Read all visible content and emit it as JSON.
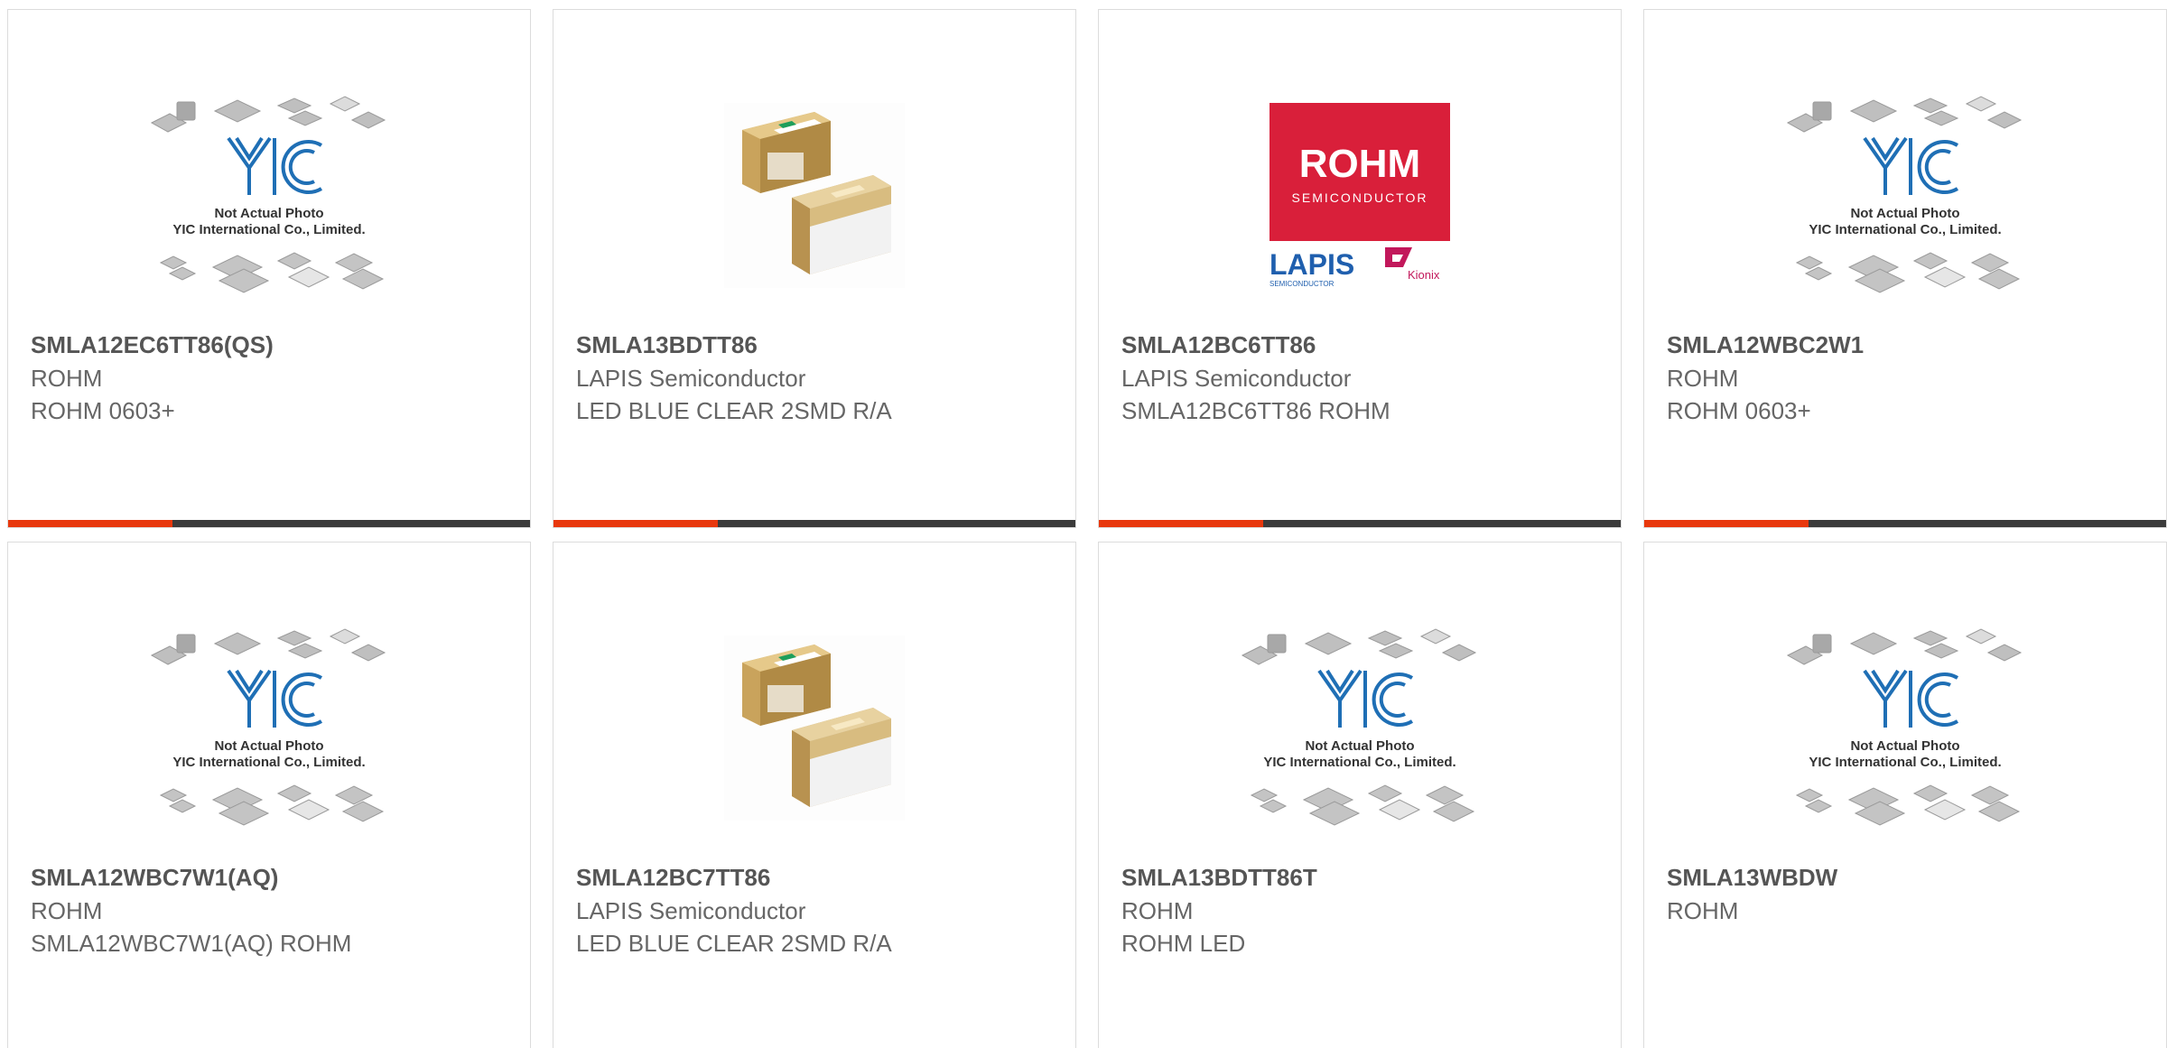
{
  "placeholder": {
    "logo_text": "YIC",
    "line1": "Not Actual Photo",
    "line2": "YIC International Co., Limited."
  },
  "rohm_logo": {
    "brand": "ROHM",
    "sub": "SEMICONDUCTOR",
    "lapis": "LAPIS",
    "lapis_sub": "SEMICONDUCTOR",
    "kionix": "Kionix"
  },
  "products": [
    {
      "part": "SMLA12EC6TT86(QS)",
      "manufacturer": "ROHM",
      "description": "ROHM 0603+",
      "image": "placeholder"
    },
    {
      "part": "SMLA13BDTT86",
      "manufacturer": "LAPIS Semiconductor",
      "description": "LED BLUE CLEAR 2SMD R/A",
      "image": "led-photo"
    },
    {
      "part": "SMLA12BC6TT86",
      "manufacturer": "LAPIS Semiconductor",
      "description": "SMLA12BC6TT86 ROHM",
      "image": "rohm-logo"
    },
    {
      "part": "SMLA12WBC2W1",
      "manufacturer": "ROHM",
      "description": "ROHM 0603+",
      "image": "placeholder"
    },
    {
      "part": "SMLA12WBC7W1(AQ)",
      "manufacturer": "ROHM",
      "description": "SMLA12WBC7W1(AQ) ROHM",
      "image": "placeholder"
    },
    {
      "part": "SMLA12BC7TT86",
      "manufacturer": "LAPIS Semiconductor",
      "description": "LED BLUE CLEAR 2SMD R/A",
      "image": "led-photo"
    },
    {
      "part": "SMLA13BDTT86T",
      "manufacturer": "ROHM",
      "description": "ROHM LED",
      "image": "placeholder"
    },
    {
      "part": "SMLA13WBDW",
      "manufacturer": "ROHM",
      "description": "",
      "image": "placeholder"
    }
  ],
  "colors": {
    "accent": "#e8380d",
    "bar": "#3b3b3b",
    "yic_blue": "#1f6fb5",
    "rohm_red": "#d91f3a"
  }
}
